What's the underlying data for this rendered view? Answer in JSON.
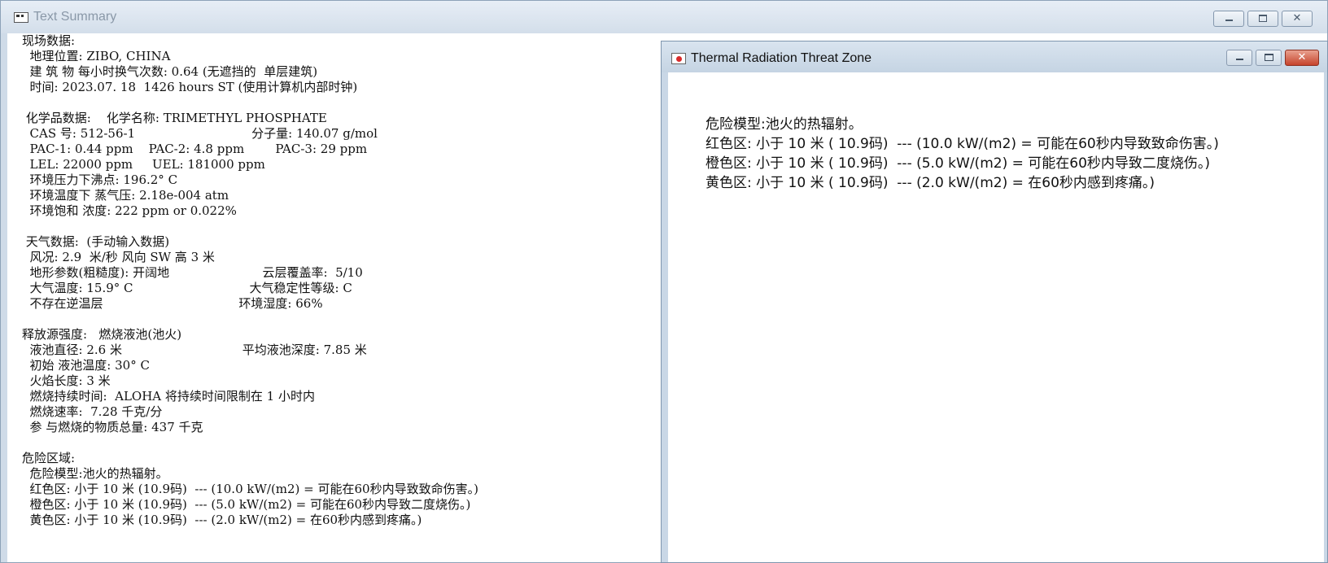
{
  "main_window": {
    "title": "Text Summary",
    "lines": [
      "现场数据:",
      "  地理位置: ZIBO, CHINA",
      "  建 筑 物 每小时换气次数: 0.64 (无遮挡的  单层建筑)",
      "  时间: 2023.07. 18  1426 hours ST (使用计算机内部时钟)",
      "",
      " 化学品数据:    化学名称: TRIMETHYL PHOSPHATE",
      "  CAS 号: 512-56-1                              分子量: 140.07 g/mol",
      "  PAC-1: 0.44 ppm    PAC-2: 4.8 ppm        PAC-3: 29 ppm",
      "  LEL: 22000 ppm     UEL: 181000 ppm",
      "  环境压力下沸点: 196.2° C",
      "  环境温度下 蒸气压: 2.18e-004 atm",
      "  环境饱和 浓度: 222 ppm or 0.022%",
      "",
      " 天气数据:  (手动输入数据)",
      "  风况: 2.9  米/秒 风向 SW 高 3 米",
      "  地形参数(粗糙度): 开阔地                        云层覆盖率:  5/10",
      "  大气温度: 15.9° C                              大气稳定性等级: C",
      "  不存在逆温层                                   环境湿度: 66%",
      "",
      "释放源强度:   燃烧液池(池火)",
      "  液池直径: 2.6 米                               平均液池深度: 7.85 米",
      "  初始 液池温度: 30° C",
      "  火焰长度: 3 米",
      "  燃烧持续时间:  ALOHA 将持续时间限制在 1 小时内",
      "  燃烧速率:  7.28 千克/分",
      "  参 与燃烧的物质总量: 437 千克",
      "",
      "危险区域:",
      "  危险模型:池火的热辐射。",
      "  红色区: 小于 10 米 (10.9码)  --- (10.0 kW/(m2) = 可能在60秒内导致致命伤害。)",
      "  橙色区: 小于 10 米 (10.9码)  --- (5.0 kW/(m2) = 可能在60秒内导致二度烧伤。)",
      "  黄色区: 小于 10 米 (10.9码)  --- (2.0 kW/(m2) = 在60秒内感到疼痛。)"
    ]
  },
  "child_window": {
    "title": "Thermal Radiation Threat Zone",
    "lines": [
      "危险模型:池火的热辐射。",
      "红色区: 小于 10 米 ( 10.9码)  --- (10.0 kW/(m2) = 可能在60秒内导致致命伤害。)",
      "橙色区: 小于 10 米 ( 10.9码)  --- (5.0 kW/(m2) = 可能在60秒内导致二度烧伤。)",
      "黄色区: 小于 10 米 ( 10.9码)  --- (2.0 kW/(m2) = 在60秒内感到疼痛。)"
    ]
  }
}
